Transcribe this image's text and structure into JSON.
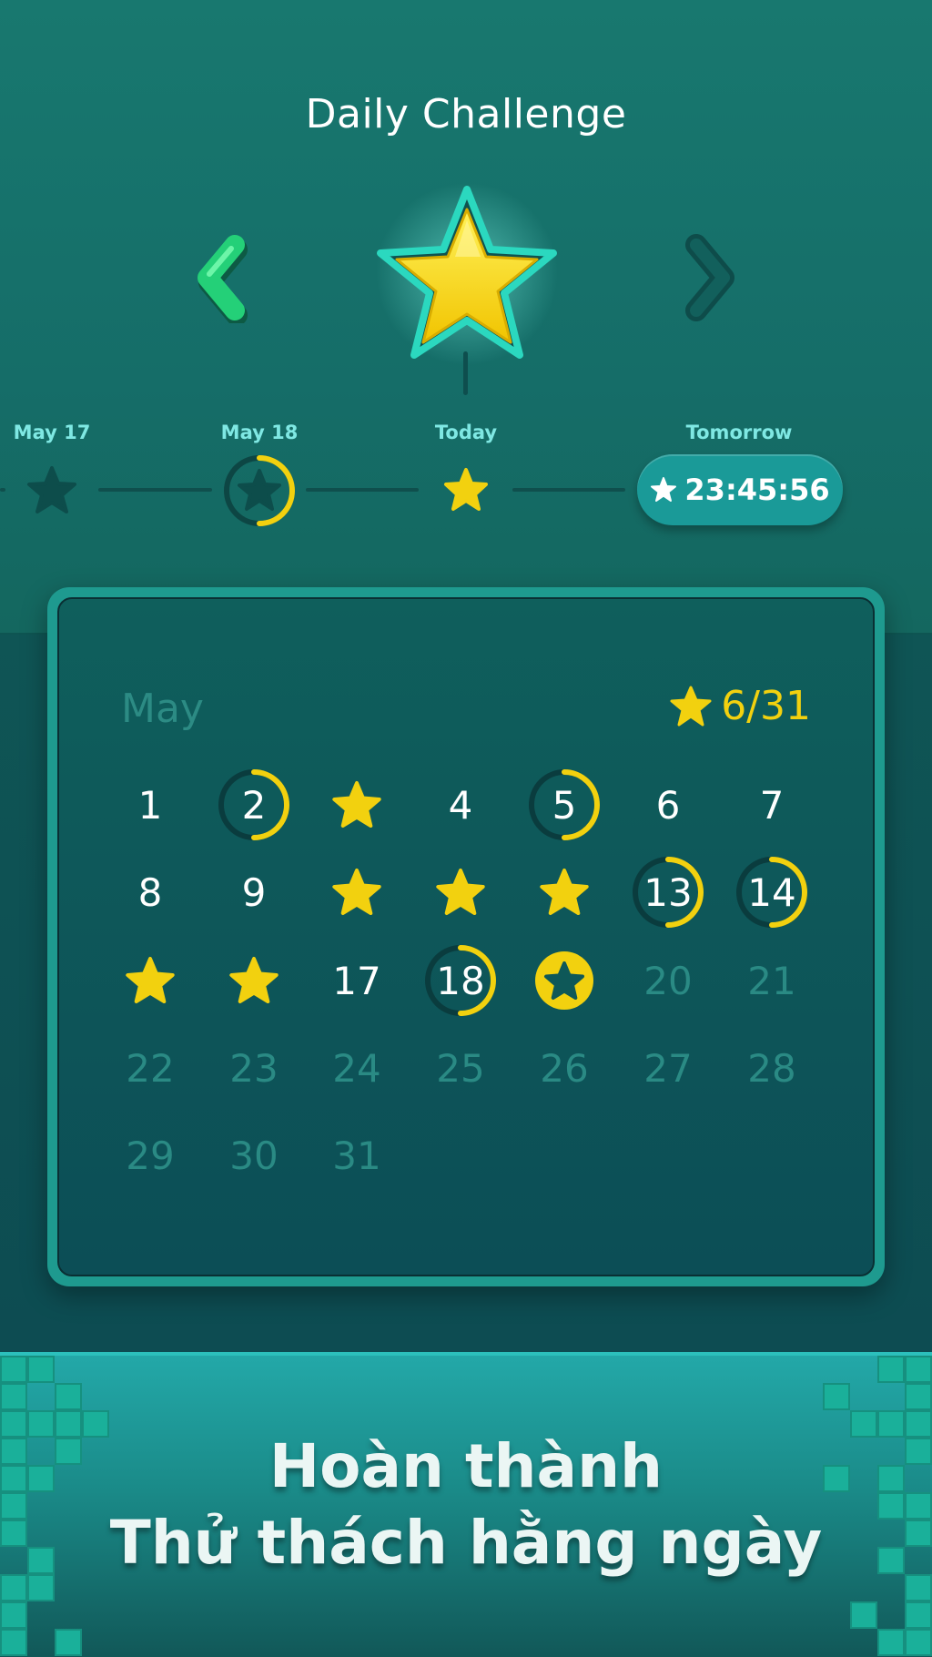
{
  "header": {
    "title": "Daily Challenge"
  },
  "nav": {
    "prev_icon": "chevron-left-icon",
    "next_icon": "chevron-right-icon",
    "hero_icon": "star-icon"
  },
  "timeline": {
    "items": [
      {
        "label": "May 17",
        "state": "star-outline"
      },
      {
        "label": "May 18",
        "state": "progress",
        "progress": 0.5
      },
      {
        "label": "Today",
        "state": "star-gold"
      },
      {
        "label": "Tomorrow",
        "timer": "23:45:56"
      }
    ]
  },
  "calendar": {
    "month": "May",
    "stars_earned": "6/31",
    "days": [
      {
        "d": "1",
        "state": "plain"
      },
      {
        "d": "2",
        "state": "progress",
        "progress": 0.5
      },
      {
        "d": "3",
        "state": "star"
      },
      {
        "d": "4",
        "state": "plain"
      },
      {
        "d": "5",
        "state": "progress",
        "progress": 0.5
      },
      {
        "d": "6",
        "state": "plain"
      },
      {
        "d": "7",
        "state": "plain"
      },
      {
        "d": "8",
        "state": "plain"
      },
      {
        "d": "9",
        "state": "plain"
      },
      {
        "d": "10",
        "state": "star"
      },
      {
        "d": "11",
        "state": "star"
      },
      {
        "d": "12",
        "state": "star"
      },
      {
        "d": "13",
        "state": "progress",
        "progress": 0.5
      },
      {
        "d": "14",
        "state": "progress",
        "progress": 0.5
      },
      {
        "d": "15",
        "state": "star"
      },
      {
        "d": "16",
        "state": "star"
      },
      {
        "d": "17",
        "state": "plain"
      },
      {
        "d": "18",
        "state": "progress",
        "progress": 0.5
      },
      {
        "d": "19",
        "state": "today"
      },
      {
        "d": "20",
        "state": "future"
      },
      {
        "d": "21",
        "state": "future"
      },
      {
        "d": "22",
        "state": "future"
      },
      {
        "d": "23",
        "state": "future"
      },
      {
        "d": "24",
        "state": "future"
      },
      {
        "d": "25",
        "state": "future"
      },
      {
        "d": "26",
        "state": "future"
      },
      {
        "d": "27",
        "state": "future"
      },
      {
        "d": "28",
        "state": "future"
      },
      {
        "d": "29",
        "state": "future"
      },
      {
        "d": "30",
        "state": "future"
      },
      {
        "d": "31",
        "state": "future"
      }
    ]
  },
  "banner": {
    "line1": "Hoàn thành",
    "line2": "Thử thách hằng ngày"
  },
  "colors": {
    "gold": "#f2d10f",
    "accent_green": "#2ee08a",
    "teal": "#1a9a98"
  }
}
